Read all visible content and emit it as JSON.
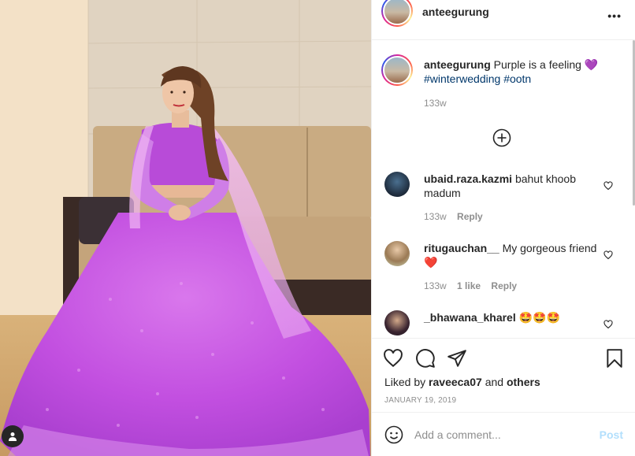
{
  "post": {
    "username": "anteegurung",
    "more_label": "•••"
  },
  "caption": {
    "username": "anteegurung",
    "text": "Purple is a feeling",
    "emoji": "💜",
    "hashtags": [
      "#winterwedding",
      "#ootn"
    ],
    "time": "133w"
  },
  "comments": [
    {
      "username": "ubaid.raza.kazmi",
      "text": "bahut khoob madum",
      "emoji": "",
      "time": "133w",
      "likes": "",
      "reply": "Reply"
    },
    {
      "username": "ritugauchan__",
      "text": "My gorgeous friend",
      "emoji": "❤️",
      "time": "133w",
      "likes": "1 like",
      "reply": "Reply"
    },
    {
      "username": "_bhawana_kharel",
      "text": "",
      "emoji": "🤩🤩🤩",
      "time": "",
      "likes": "",
      "reply": ""
    }
  ],
  "likes": {
    "prefix": "Liked by",
    "user": "raveeca07",
    "conj": "and",
    "others": "others"
  },
  "date": "JANUARY 19, 2019",
  "add_comment": {
    "placeholder": "Add a comment...",
    "post_label": "Post"
  },
  "icons": {
    "more": "more-horizontal-icon",
    "load_more": "plus-circle-icon",
    "like": "heart-icon",
    "comment": "comment-bubble-icon",
    "share": "paper-plane-icon",
    "save": "bookmark-icon",
    "emoji": "smiley-icon",
    "tag": "user-tag-icon"
  },
  "colors": {
    "link": "#00376b",
    "muted": "#8e8e8e",
    "post_disabled": "#b2dffc",
    "dress": "#c84bdc"
  }
}
